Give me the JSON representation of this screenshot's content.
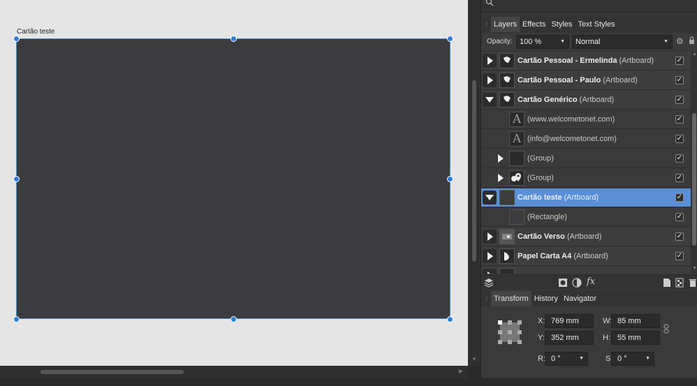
{
  "canvas": {
    "artboard_label": "Cartão teste"
  },
  "layers_panel": {
    "tabs": [
      {
        "label": "Layers",
        "active": true
      },
      {
        "label": "Effects",
        "active": false
      },
      {
        "label": "Styles",
        "active": false
      },
      {
        "label": "Text Styles",
        "active": false
      }
    ],
    "opacity_label": "Opacity:",
    "opacity_value": "100 %",
    "blend_mode": "Normal",
    "layers": [
      {
        "name": "Cartão Pessoal - Ermelinda",
        "type": "(Artboard)",
        "expand": "collapsed",
        "thumb": "artboard-icon",
        "bold": true
      },
      {
        "name": "Cartão Pessoal - Paulo",
        "type": "(Artboard)",
        "expand": "collapsed",
        "thumb": "artboard-icon",
        "bold": true
      },
      {
        "name": "Cartão Genérico",
        "type": "(Artboard)",
        "expand": "expanded",
        "thumb": "artboard-icon",
        "bold": true
      },
      {
        "name": "",
        "type": "(www.welcometonet.com)",
        "expand": "none",
        "thumb": "text-icon",
        "bold": false
      },
      {
        "name": "",
        "type": "(info@welcometonet.com)",
        "expand": "none",
        "thumb": "text-icon",
        "bold": false
      },
      {
        "name": "",
        "type": "(Group)",
        "expand": "collapsed",
        "thumb": "group-icon",
        "bold": false
      },
      {
        "name": "",
        "type": "(Group)",
        "expand": "collapsed",
        "thumb": "pin-icon",
        "bold": false
      },
      {
        "name": "Cartão teste",
        "type": "(Artboard)",
        "expand": "expanded",
        "thumb": "artboard-icon",
        "bold": true,
        "selected": true
      },
      {
        "name": "",
        "type": "(Rectangle)",
        "expand": "none",
        "thumb": "rectangle-icon",
        "bold": false
      },
      {
        "name": "Cartão Verso",
        "type": "(Artboard)",
        "expand": "collapsed",
        "thumb": "artboard-icon",
        "bold": true
      },
      {
        "name": "Papel Carta A4",
        "type": "(Artboard)",
        "expand": "collapsed",
        "thumb": "artboard-icon",
        "bold": true
      }
    ]
  },
  "transform_panel": {
    "tabs": [
      {
        "label": "Transform",
        "active": true
      },
      {
        "label": "History",
        "active": false
      },
      {
        "label": "Navigator",
        "active": false
      }
    ],
    "x_label": "X:",
    "x_value": "769 mm",
    "y_label": "Y:",
    "y_value": "352 mm",
    "w_label": "W:",
    "w_value": "85 mm",
    "h_label": "H:",
    "h_value": "55 mm",
    "r_label": "R:",
    "r_value": "0 °",
    "s_label": "S:",
    "s_value": "0 °"
  },
  "colors": {
    "selection": "#5b8fd6",
    "handle": "#2d7fd6",
    "artboard_fill": "#3c3c3e"
  }
}
